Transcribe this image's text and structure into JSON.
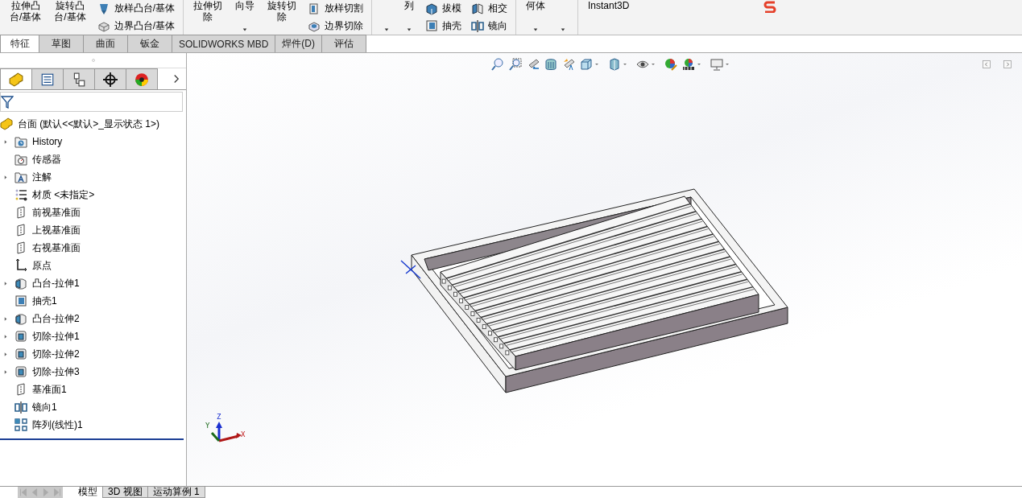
{
  "ribbon": [
    {
      "kind": "big",
      "lines": [
        "拉伸凸",
        "台/基体"
      ],
      "dropdown": false
    },
    {
      "kind": "big",
      "lines": [
        "旋转凸",
        "台/基体"
      ],
      "dropdown": false
    },
    {
      "kind": "pair",
      "items": [
        {
          "label": "放样凸台/基体"
        },
        {
          "label": "边界凸台/基体"
        }
      ]
    },
    {
      "kind": "sep"
    },
    {
      "kind": "big",
      "lines": [
        "拉伸切",
        "除"
      ],
      "dropdown": false
    },
    {
      "kind": "big",
      "lines": [
        "向导"
      ],
      "dropdown": true
    },
    {
      "kind": "big",
      "lines": [
        "旋转切",
        "除"
      ],
      "dropdown": false
    },
    {
      "kind": "pair",
      "items": [
        {
          "label": "放样切割"
        },
        {
          "label": "边界切除"
        }
      ]
    },
    {
      "kind": "sep"
    },
    {
      "kind": "big",
      "dropdown": true
    },
    {
      "kind": "big",
      "lines": [
        "列"
      ],
      "dropdown": true
    },
    {
      "kind": "pair",
      "items": [
        {
          "label": "拔模"
        },
        {
          "label": "抽壳"
        }
      ]
    },
    {
      "kind": "pair",
      "items": [
        {
          "label": "相交"
        },
        {
          "label": "镜向"
        }
      ]
    },
    {
      "kind": "sep"
    },
    {
      "kind": "big",
      "lines": [
        "何体"
      ],
      "dropdown": true
    },
    {
      "kind": "big",
      "dropdown": true
    },
    {
      "kind": "sep"
    },
    {
      "kind": "big",
      "lines": [
        "Instant3D"
      ],
      "dropdown": false
    }
  ],
  "tabs": [
    {
      "label": "特征",
      "selected": true
    },
    {
      "label": "草图",
      "selected": false
    },
    {
      "label": "曲面",
      "selected": false
    },
    {
      "label": "钣金",
      "selected": false
    },
    {
      "label": "SOLIDWORKS MBD",
      "selected": false
    },
    {
      "label": "焊件(D)",
      "selected": false
    },
    {
      "label": "评估",
      "selected": false
    }
  ],
  "panel": {
    "tabs": [
      {
        "kind": "feature-tree",
        "selected": true
      },
      {
        "kind": "property",
        "selected": false
      },
      {
        "kind": "config",
        "selected": false
      },
      {
        "kind": "dimxpert",
        "selected": false
      },
      {
        "kind": "display",
        "selected": false
      }
    ],
    "root": {
      "label": "台面  (默认<<默认>_显示状态 1>)"
    },
    "tree": [
      {
        "label": "History",
        "kind": "history",
        "expandable": true
      },
      {
        "label": "传感器",
        "kind": "sensors",
        "expandable": false
      },
      {
        "label": "注解",
        "kind": "annotations",
        "expandable": true
      },
      {
        "label": "材质 <未指定>",
        "kind": "material",
        "expandable": false
      },
      {
        "label": "前视基准面",
        "kind": "plane",
        "expandable": false
      },
      {
        "label": "上视基准面",
        "kind": "plane",
        "expandable": false
      },
      {
        "label": "右视基准面",
        "kind": "plane",
        "expandable": false
      },
      {
        "label": "原点",
        "kind": "origin",
        "expandable": false
      },
      {
        "label": "凸台-拉伸1",
        "kind": "boss",
        "expandable": true
      },
      {
        "label": "抽壳1",
        "kind": "shell",
        "expandable": false
      },
      {
        "label": "凸台-拉伸2",
        "kind": "boss",
        "expandable": true
      },
      {
        "label": "切除-拉伸1",
        "kind": "cut",
        "expandable": true
      },
      {
        "label": "切除-拉伸2",
        "kind": "cut",
        "expandable": true
      },
      {
        "label": "切除-拉伸3",
        "kind": "cut",
        "expandable": true
      },
      {
        "label": "基准面1",
        "kind": "plane",
        "expandable": false
      },
      {
        "label": "镜向1",
        "kind": "mirror",
        "expandable": false
      },
      {
        "label": "阵列(线性)1",
        "kind": "pattern",
        "expandable": false
      }
    ]
  },
  "view": {
    "triad": {
      "x": "X",
      "y": "Y",
      "z": "Z"
    }
  },
  "bottom_tabs": [
    {
      "label": "模型",
      "selected": true
    },
    {
      "label": "3D 视图",
      "selected": false
    },
    {
      "label": "运动算例 1",
      "selected": false
    }
  ]
}
